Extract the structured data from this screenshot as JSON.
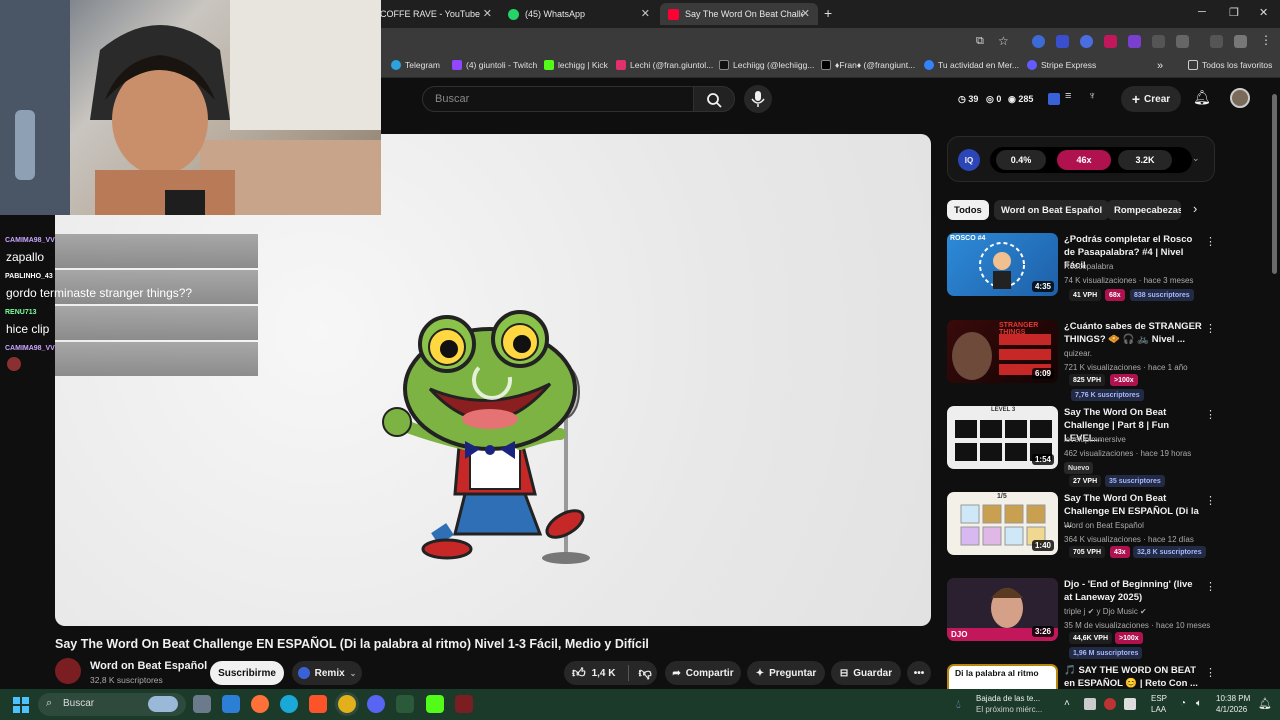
{
  "browser": {
    "tabs": [
      {
        "label": "COFFE RAVE - YouTube"
      },
      {
        "label": "(45) WhatsApp"
      },
      {
        "label": "Say The Word On Beat Challeng"
      }
    ],
    "new_tab": "+",
    "bookmarks": [
      {
        "label": "Telegram"
      },
      {
        "label": "(4) giuntoli - Twitch"
      },
      {
        "label": "lechigg | Kick"
      },
      {
        "label": "Lechi (@fran.giuntol..."
      },
      {
        "label": "Lechiigg (@lechiigg..."
      },
      {
        "label": "♦Fran♦ (@frangiunt..."
      },
      {
        "label": "Tu actividad en Mer..."
      },
      {
        "label": "Stripe Express"
      }
    ],
    "all_favorites": "Todos los favoritos"
  },
  "header": {
    "search_placeholder": "Buscar",
    "stat_1": "39",
    "stat_2": "0",
    "stat_3": "285",
    "create_label": "Crear"
  },
  "chat": [
    {
      "user": "CAMIMA98_VV",
      "message": "zapallo",
      "color": "#c9a6ff"
    },
    {
      "user": "PABLINHO_43",
      "message": "gordo terminaste stranger things??",
      "color": "#ffffff"
    },
    {
      "user": "RENU713",
      "message": "hice clip",
      "color": "#7dff9a"
    },
    {
      "user": "CAMIMA98_VV",
      "message": "",
      "color": "#c9a6ff"
    }
  ],
  "video": {
    "title": "Say The Word On Beat Challenge EN ESPAÑOL (Di la palabra al ritmo) Nivel 1-3 Fácil, Medio y Difícil",
    "channel": "Word on Beat Español",
    "subscribers": "32,8 K suscriptores",
    "subscribe_label": "Suscribirme",
    "remix_label": "Remix",
    "likes": "1,4 K",
    "share_label": "Compartir",
    "ask_label": "Preguntar",
    "save_label": "Guardar"
  },
  "iq": {
    "label": "IQ",
    "seg1": "0.4%",
    "seg2": "46x",
    "seg3": "3.2K"
  },
  "chips": [
    "Todos",
    "Word on Beat Español",
    "Rompecabezas"
  ],
  "recommendations": [
    {
      "title": "¿Podrás completar el Rosco de Pasapalabra? #4 | Nivel Fácil",
      "channel": "Roscopalabra",
      "meta": "74 K visualizaciones · hace 3 meses",
      "duration": "4:35",
      "vph": "41 VPH",
      "mult": "68x",
      "subs": "838 suscriptores",
      "thumb_label": "ROSCO #4"
    },
    {
      "title": "¿Cuánto sabes de STRANGER THINGS? 🧇 🎧 🚲 Nivel ...",
      "channel": "quizear.",
      "meta": "721 K visualizaciones · hace 1 año",
      "duration": "6:09",
      "vph": "825 VPH",
      "mult": ">100x",
      "subs": "7,76 K suscriptores",
      "thumb_label": "STRANGER THINGS"
    },
    {
      "title": "Say The Word On Beat Challenge | Part 8 | Fun LEVEL...",
      "channel": "levelupimmersive",
      "meta": "462 visualizaciones · hace 19 horas",
      "duration": "1:54",
      "badge_new": "Nuevo",
      "vph": "27 VPH",
      "subs": "35 suscriptores",
      "thumb_label": "LEVEL 3"
    },
    {
      "title": "Say The Word On Beat Challenge EN ESPAÑOL (Di la ...",
      "channel": "Word on Beat Español",
      "meta": "364 K visualizaciones · hace 12 días",
      "duration": "1:40",
      "vph": "705 VPH",
      "mult": "43x",
      "subs": "32,8 K suscriptores",
      "thumb_label": "1/5"
    },
    {
      "title": "Djo - 'End of Beginning' (live at Laneway 2025)",
      "channel": "triple j ✔ y Djo Music ✔",
      "meta": "35 M de visualizaciones · hace 10 meses",
      "duration": "3:26",
      "vph": "44,6K VPH",
      "mult": ">100x",
      "subs": "1,96 M suscriptores",
      "thumb_label": "DJO"
    },
    {
      "title": "🎵 SAY THE WORD ON BEAT en ESPAÑOL 😊 | Reto Con ...",
      "channel": "",
      "meta": "",
      "thumb_label": "Di la palabra al ritmo"
    }
  ],
  "taskbar": {
    "search_placeholder": "Buscar",
    "notification": "Bajada de las te...",
    "notification_sub": "El próximo miérc...",
    "lang": "ESP",
    "lang_sub": "LAA",
    "time": "10:38 PM",
    "date": "4/1/2026"
  },
  "colors": {
    "accent_red": "#ff0033",
    "iq_magenta": "#b0124f",
    "taskbar": "#1b3a2a"
  }
}
